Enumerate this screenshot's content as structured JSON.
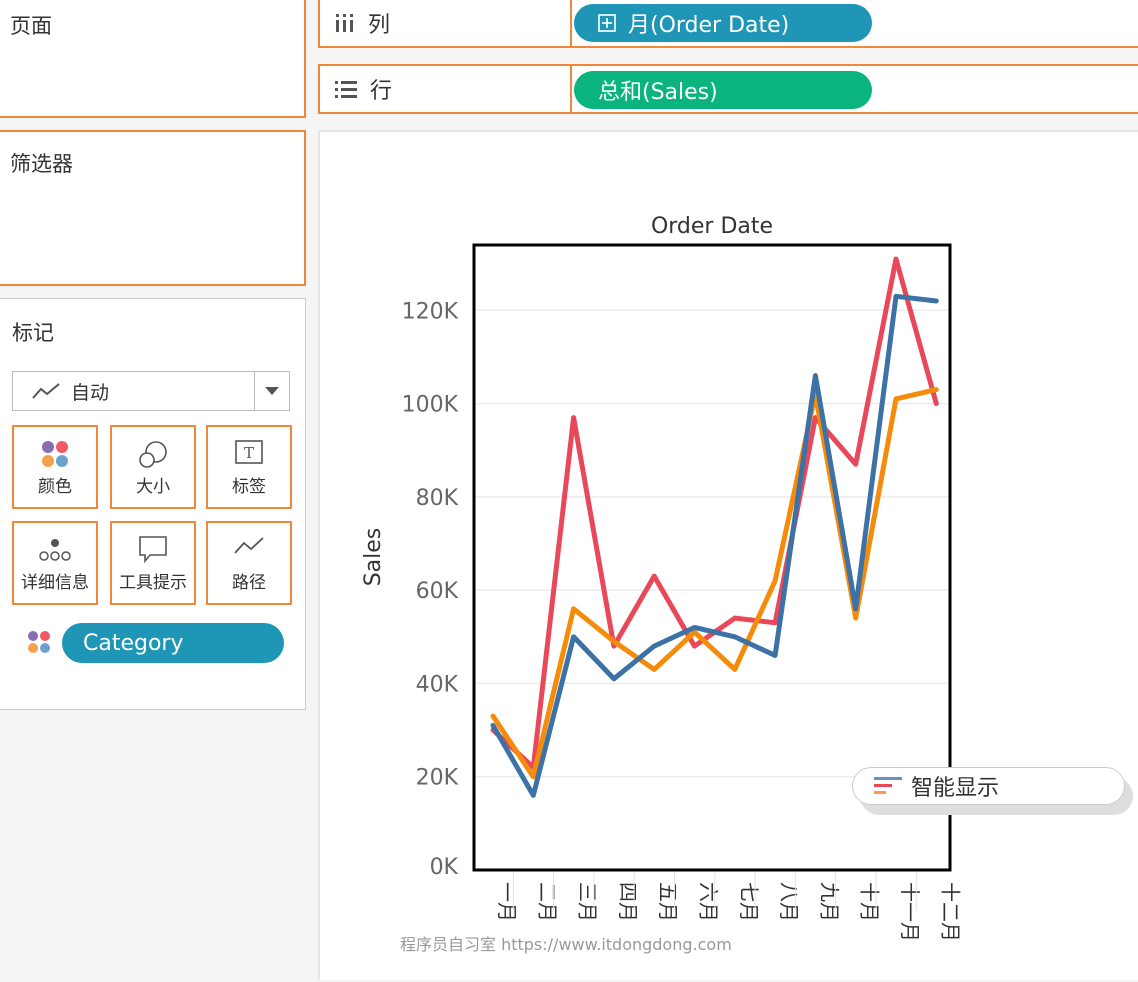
{
  "pages_panel": {
    "title": "页面"
  },
  "filters_panel": {
    "title": "筛选器"
  },
  "marks_panel": {
    "title": "标记",
    "mark_type": "自动",
    "cards": [
      {
        "label": "颜色",
        "icon": "color-icon"
      },
      {
        "label": "大小",
        "icon": "size-icon"
      },
      {
        "label": "标签",
        "icon": "text-label-icon"
      },
      {
        "label": "详细信息",
        "icon": "detail-icon"
      },
      {
        "label": "工具提示",
        "icon": "tooltip-icon"
      },
      {
        "label": "路径",
        "icon": "path-icon"
      }
    ],
    "color_field": "Category",
    "color_field_pill_color": "#1f96b5"
  },
  "columns_shelf": {
    "label": "列",
    "pill": "月(Order Date)",
    "pill_color": "#1f96b5"
  },
  "rows_shelf": {
    "label": "行",
    "pill": "总和(Sales)",
    "pill_color": "#0bb37e"
  },
  "show_me": {
    "label": "智能显示"
  },
  "watermark": "程序员自习室 https://www.itdongdong.com",
  "colors": {
    "accent_border": "#f0883a"
  },
  "chart_data": {
    "type": "line",
    "title": "Order Date",
    "xlabel": "",
    "ylabel": "Sales",
    "categories": [
      "一月",
      "二月",
      "三月",
      "四月",
      "五月",
      "六月",
      "七月",
      "八月",
      "九月",
      "十月",
      "十一月",
      "十二月"
    ],
    "yticks": [
      "0K",
      "20K",
      "40K",
      "60K",
      "80K",
      "100K",
      "120K"
    ],
    "ylim": [
      0,
      134000
    ],
    "grid": true,
    "series": [
      {
        "color": "#e8485a",
        "values": [
          30000,
          22000,
          97000,
          48000,
          63000,
          48000,
          54000,
          53000,
          97000,
          87000,
          131000,
          100000
        ]
      },
      {
        "color": "#f58b0a",
        "values": [
          33000,
          20000,
          56000,
          49000,
          43000,
          51000,
          43000,
          62000,
          102000,
          54000,
          101000,
          103000
        ]
      },
      {
        "color": "#3c72a6",
        "values": [
          31000,
          16000,
          50000,
          41000,
          48000,
          52000,
          50000,
          46000,
          106000,
          56000,
          123000,
          122000
        ]
      }
    ]
  }
}
